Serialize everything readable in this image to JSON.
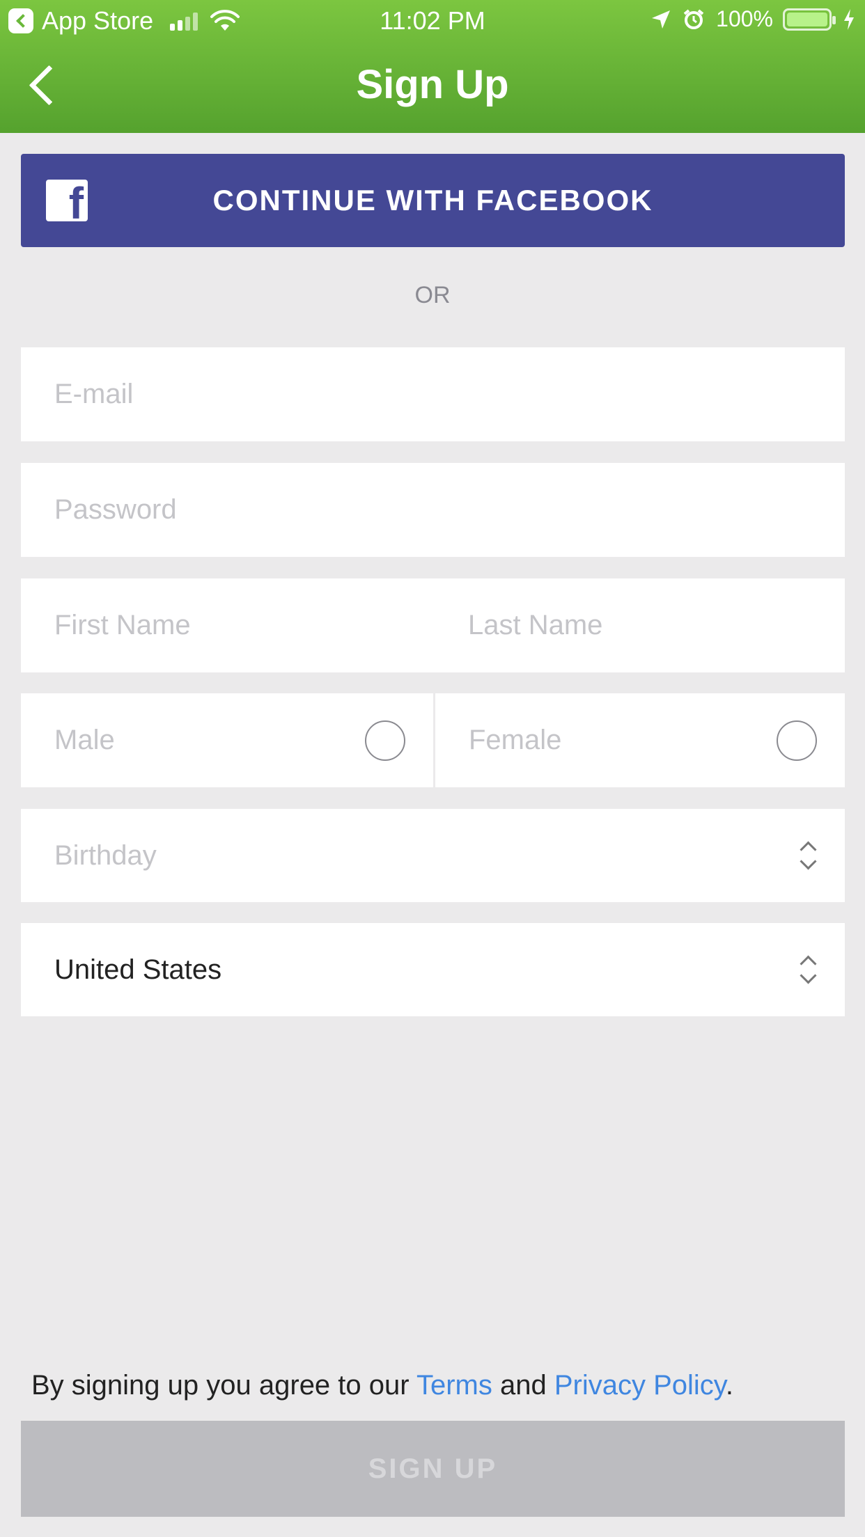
{
  "status_bar": {
    "back_app": "App Store",
    "time": "11:02 PM",
    "battery": "100%",
    "icons": [
      "back-arrow-icon",
      "signal-icon",
      "wifi-icon",
      "location-icon",
      "alarm-icon",
      "battery-icon",
      "charging-icon"
    ]
  },
  "nav": {
    "title": "Sign Up",
    "back_icon": "chevron-left-icon"
  },
  "facebook": {
    "label": "CONTINUE WITH FACEBOOK",
    "logo": "f",
    "color": "#444895"
  },
  "divider": {
    "text": "OR"
  },
  "form": {
    "email_placeholder": "E-mail",
    "password_placeholder": "Password",
    "first_name_placeholder": "First Name",
    "last_name_placeholder": "Last Name",
    "gender_male": "Male",
    "gender_female": "Female",
    "birthday_placeholder": "Birthday",
    "country_value": "United States"
  },
  "terms": {
    "prefix": "By signing up you agree to our ",
    "terms_link": "Terms",
    "middle": " and ",
    "privacy_link": "Privacy Policy",
    "suffix": "."
  },
  "signup_button": {
    "label": "SIGN UP"
  },
  "colors": {
    "header_top": "#7cc640",
    "header_bottom": "#55a22e",
    "link": "#3f86e0",
    "background": "#ebeaeb"
  }
}
